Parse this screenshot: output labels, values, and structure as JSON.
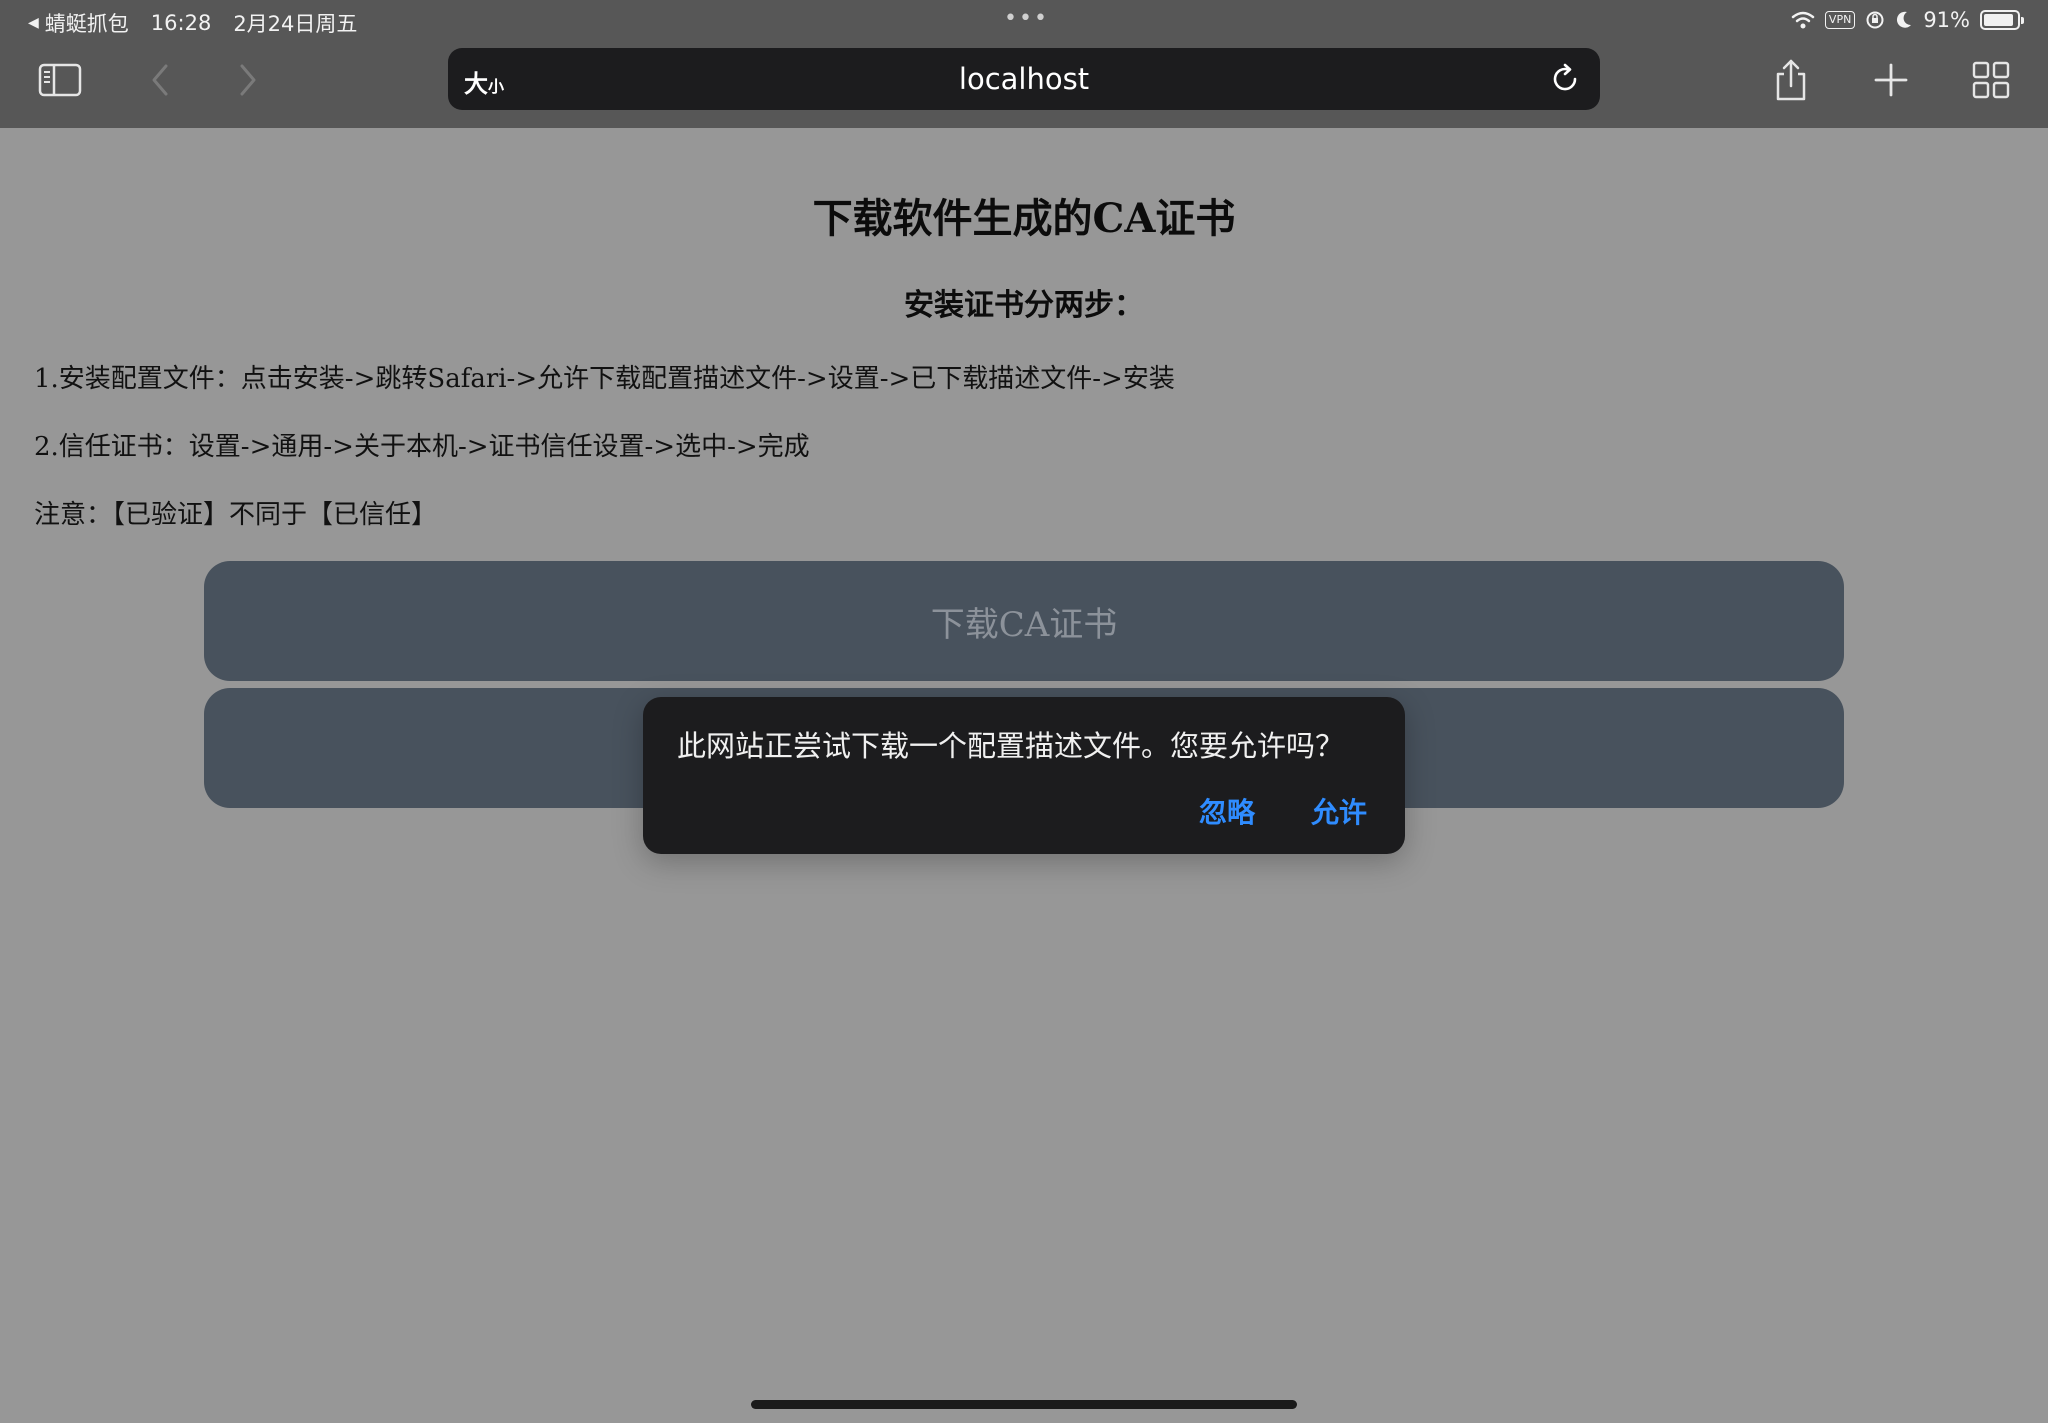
{
  "status_bar": {
    "back_app": "蜻蜓抓包",
    "time": "16:28",
    "date": "2月24日周五",
    "dots": "•••",
    "vpn": "VPN",
    "battery": "91%",
    "battery_level": 0.91
  },
  "toolbar": {
    "sidebar_icon": "sidebar-icon",
    "back_icon": "chevron-left-icon",
    "forward_icon": "chevron-right-icon",
    "share_icon": "share-icon",
    "add_icon": "plus-icon",
    "tabs_icon": "tabs-grid-icon"
  },
  "url_bar": {
    "size_label_big": "大",
    "size_label_small": "小",
    "url": "localhost"
  },
  "page": {
    "title": "下载软件生成的CA证书",
    "subtitle": "安装证书分两步：",
    "step1": "1.安装配置文件：点击安装->跳转Safari->允许下载配置描述文件->设置->已下载描述文件->安装",
    "step2": "2.信任证书：设置->通用->关于本机->证书信任设置->选中->完成",
    "note": "注意：【已验证】不同于【已信任】",
    "download_button": "下载CA证书"
  },
  "dialog": {
    "message": "此网站正尝试下载一个配置描述文件。您要允许吗？",
    "ignore": "忽略",
    "allow": "允许"
  },
  "colors": {
    "accent": "#2f8cff",
    "page_bg": "#979797",
    "button_bg": "#48525d",
    "chrome_bg": "#575757"
  }
}
